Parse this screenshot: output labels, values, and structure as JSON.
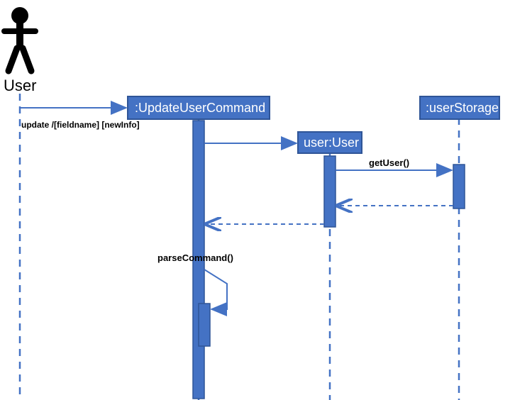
{
  "diagram": {
    "type": "sequence",
    "actor": {
      "label": "User"
    },
    "participants": {
      "updateCmd": ":UpdateUserCommand",
      "user": "user:User",
      "storage": ":userStorage"
    },
    "messages": {
      "m1": "update /[fieldname] [newInfo]",
      "m2": "getUser()",
      "m3": "parseCommand()"
    }
  },
  "chart_data": {
    "type": "sequence-diagram",
    "lifelines": [
      {
        "id": "User",
        "kind": "actor"
      },
      {
        "id": ":UpdateUserCommand",
        "kind": "object"
      },
      {
        "id": "user:User",
        "kind": "object"
      },
      {
        "id": ":userStorage",
        "kind": "object"
      }
    ],
    "messages": [
      {
        "from": "User",
        "to": ":UpdateUserCommand",
        "label": "update /[fieldname] [newInfo]",
        "type": "sync"
      },
      {
        "from": ":UpdateUserCommand",
        "to": "user:User",
        "label": "",
        "type": "sync"
      },
      {
        "from": "user:User",
        "to": ":userStorage",
        "label": "getUser()",
        "type": "sync"
      },
      {
        "from": ":userStorage",
        "to": "user:User",
        "label": "",
        "type": "return"
      },
      {
        "from": "user:User",
        "to": ":UpdateUserCommand",
        "label": "",
        "type": "return"
      },
      {
        "from": ":UpdateUserCommand",
        "to": ":UpdateUserCommand",
        "label": "parseCommand()",
        "type": "self"
      }
    ]
  }
}
